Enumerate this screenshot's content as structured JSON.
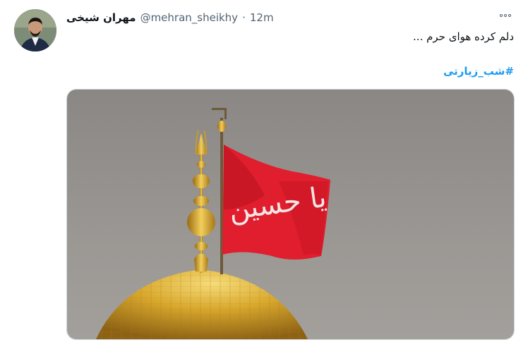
{
  "tweet": {
    "display_name": "مهران شیخی",
    "handle": "@mehran_sheikhy",
    "separator": "·",
    "time": "12m",
    "text": "دلم کرده هوای حرم ...",
    "hashtag": "#شب_زیارتی"
  },
  "icons": {
    "more": "more-horizontal-icon"
  },
  "media": {
    "flag_text": "یا حسین"
  },
  "colors": {
    "link": "#1d9bf0",
    "text": "#0f1419",
    "muted": "#536471",
    "flag": "#e01e2e",
    "dome_gold": "#d9a82c"
  }
}
